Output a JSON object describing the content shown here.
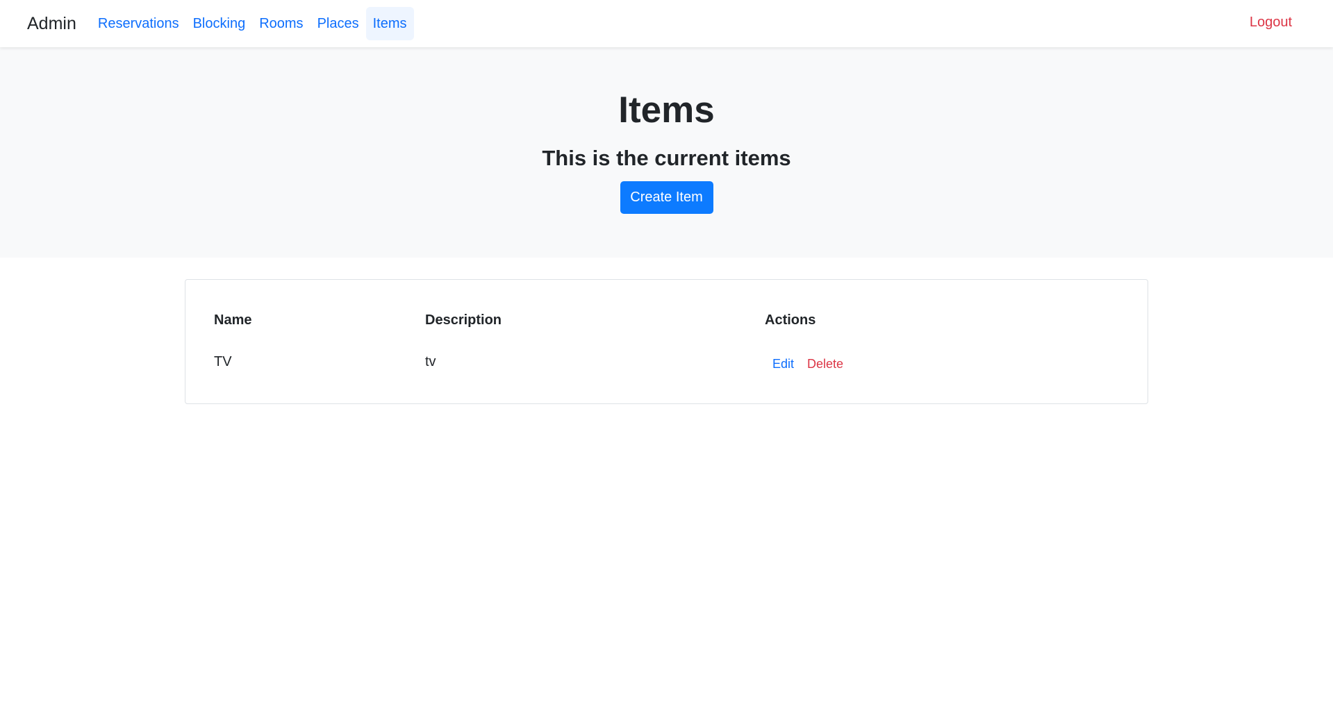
{
  "nav": {
    "brand": "Admin",
    "links": [
      "Reservations",
      "Blocking",
      "Rooms",
      "Places",
      "Items"
    ],
    "active": "Items",
    "logout": "Logout"
  },
  "hero": {
    "title": "Items",
    "subtitle": "This is the current items",
    "create_button": "Create Item"
  },
  "table": {
    "headers": [
      "Name",
      "Description",
      "Actions"
    ],
    "rows": [
      {
        "name": "TV",
        "description": "tv",
        "edit": "Edit",
        "delete": "Delete"
      }
    ]
  },
  "colors": {
    "primary": "#0d6efd",
    "danger": "#dc3545",
    "hero_bg": "#f8f9fa"
  }
}
